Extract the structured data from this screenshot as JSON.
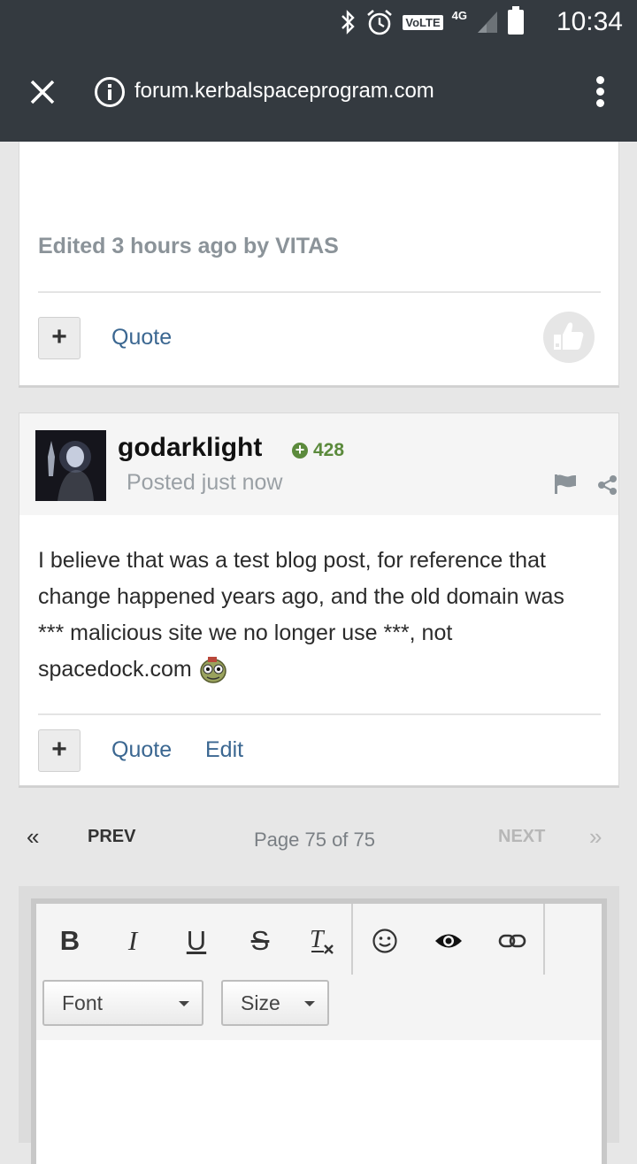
{
  "status_bar": {
    "time": "10:34",
    "volte": "VoLTE",
    "network": "4G",
    "icons": [
      "bluetooth-icon",
      "alarm-icon",
      "signal-icon",
      "battery-icon"
    ]
  },
  "browser": {
    "url": "forum.kerbalspaceprogram.com",
    "icons": [
      "close-icon",
      "info-icon",
      "more-vert-icon"
    ]
  },
  "post1": {
    "edited_note": "Edited 3 hours ago by VITAS",
    "plus_label": "+",
    "quote_label": "Quote"
  },
  "post2": {
    "username": "godarklight",
    "reputation": "428",
    "posted": "Posted just now",
    "body": "I believe that was a test blog post, for reference that change happened years ago, and the old domain was *** malicious site we no longer use ***, not spacedock.com",
    "plus_label": "+",
    "quote_label": "Quote",
    "edit_label": "Edit"
  },
  "pagination": {
    "first": "«",
    "prev": "PREV",
    "page_label": "Page 75 of 75",
    "next": "NEXT",
    "last": "»"
  },
  "editor": {
    "toolbar": [
      "bold",
      "italic",
      "underline",
      "strikethrough",
      "remove-format",
      "emoji",
      "preview",
      "link"
    ],
    "bold": "B",
    "italic": "I",
    "underline": "U",
    "strike": "S",
    "font_label": "Font",
    "size_label": "Size"
  },
  "colors": {
    "header_bg": "#343a40",
    "link": "#3b6791",
    "reputation": "#5b8a3c",
    "muted": "#8b9399"
  }
}
